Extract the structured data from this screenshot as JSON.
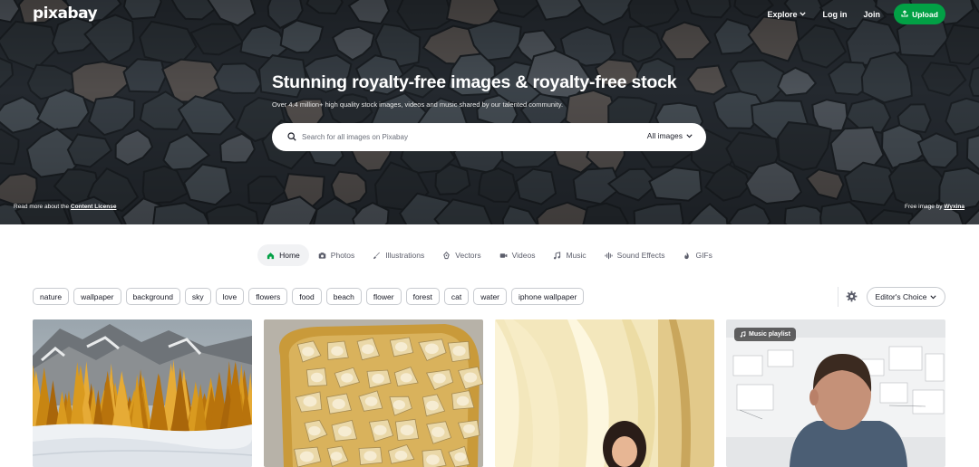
{
  "brand": {
    "logo": "pixabay"
  },
  "nav": {
    "explore": "Explore",
    "login": "Log in",
    "join": "Join",
    "upload": "Upload"
  },
  "hero": {
    "title": "Stunning royalty-free images & royalty-free stock",
    "subtitle": "Over 4.4 million+ high quality stock images, videos and music shared by our talented community.",
    "license_prefix": "Read more about the",
    "license_link": "Content License",
    "credit_prefix": "Free image by",
    "credit_author": "Wyxina"
  },
  "search": {
    "placeholder": "Search for all images on Pixabay",
    "scope": "All images"
  },
  "tabs": [
    {
      "label": "Home",
      "icon": "home-icon",
      "active": true
    },
    {
      "label": "Photos",
      "icon": "camera-icon"
    },
    {
      "label": "Illustrations",
      "icon": "brush-icon"
    },
    {
      "label": "Vectors",
      "icon": "pen-nib-icon"
    },
    {
      "label": "Videos",
      "icon": "video-icon"
    },
    {
      "label": "Music",
      "icon": "music-note-icon"
    },
    {
      "label": "Sound Effects",
      "icon": "sound-wave-icon"
    },
    {
      "label": "GIFs",
      "icon": "flame-icon"
    }
  ],
  "filters": [
    "nature",
    "wallpaper",
    "background",
    "sky",
    "love",
    "flowers",
    "food",
    "beach",
    "flower",
    "forest",
    "cat",
    "water",
    "iphone wallpaper"
  ],
  "sort": {
    "label": "Editor's Choice"
  },
  "cards": [
    {
      "subject": "snowy-larch-forest",
      "badge": ""
    },
    {
      "subject": "powdered-ravioli-tray",
      "badge": ""
    },
    {
      "subject": "woman-by-curtains",
      "badge": ""
    },
    {
      "subject": "man-at-whiteboard",
      "badge": "Music playlist"
    }
  ],
  "colors": {
    "accent": "#02a045",
    "text": "#191b26",
    "muted": "#5c5e6b"
  }
}
